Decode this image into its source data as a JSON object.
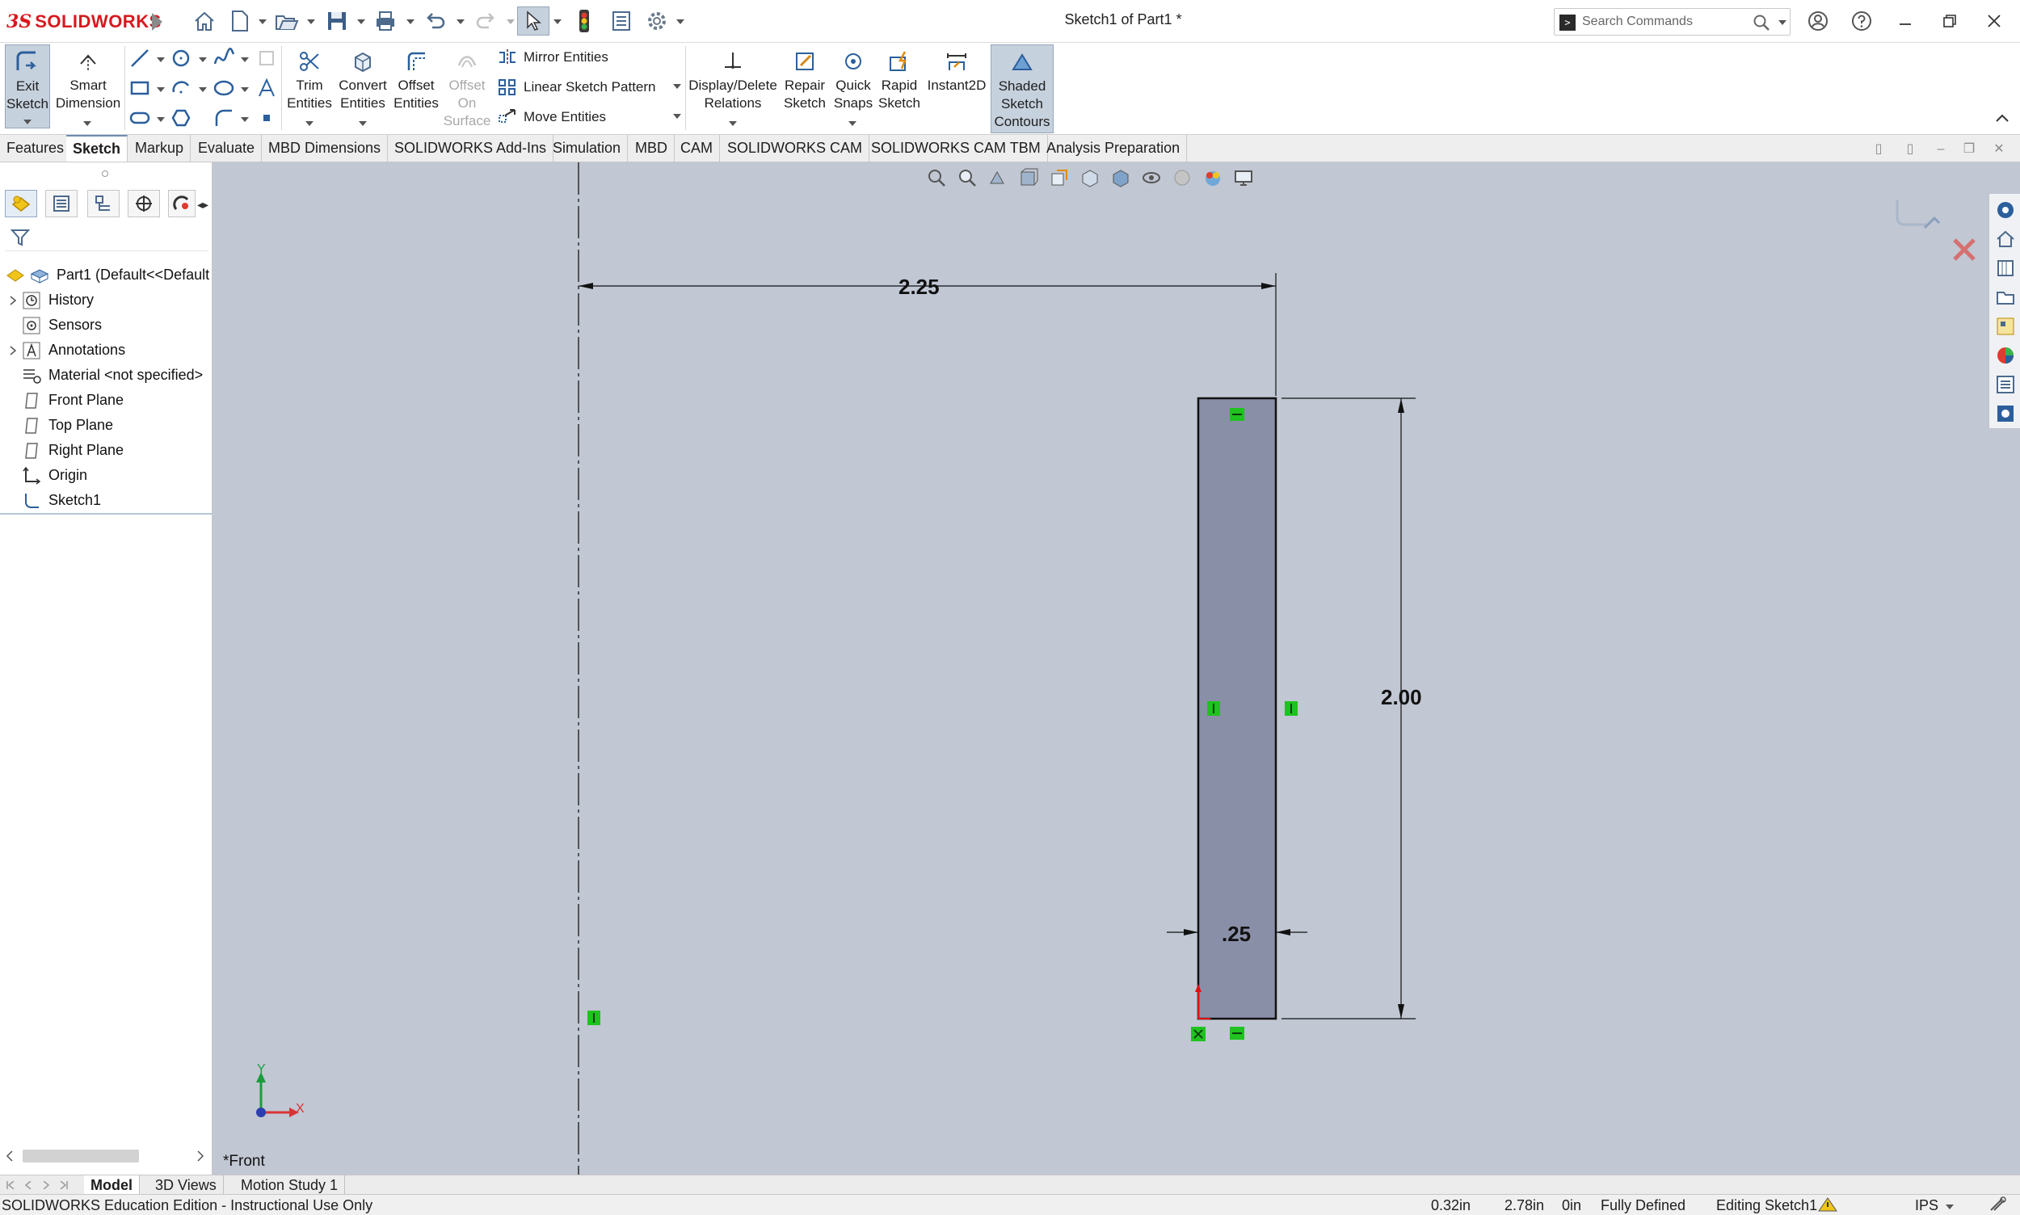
{
  "titlebar": {
    "brand": "SOLIDWORKS",
    "document_title": "Sketch1 of Part1 *",
    "search_placeholder": "Search Commands",
    "quick_access_icons": [
      "home-icon",
      "new-file-icon",
      "open-icon",
      "save-icon",
      "print-icon",
      "undo-icon",
      "redo-icon",
      "select-icon",
      "rebuild-icon",
      "file-properties-icon",
      "options-icon"
    ]
  },
  "ribbon": {
    "exit_sketch": [
      "Exit",
      "Sketch"
    ],
    "smart_dimension": [
      "Smart",
      "Dimension"
    ],
    "trim_entities": [
      "Trim",
      "Entities"
    ],
    "convert_entities": [
      "Convert",
      "Entities"
    ],
    "offset_entities": [
      "Offset",
      "Entities"
    ],
    "offset_on_surface": [
      "Offset",
      "On",
      "Surface"
    ],
    "mirror_entities": "Mirror Entities",
    "linear_sketch_pattern": "Linear Sketch Pattern",
    "move_entities": "Move Entities",
    "display_delete_relations": [
      "Display/Delete",
      "Relations"
    ],
    "repair_sketch": [
      "Repair",
      "Sketch"
    ],
    "quick_snaps": [
      "Quick",
      "Snaps"
    ],
    "rapid_sketch": [
      "Rapid",
      "Sketch"
    ],
    "instant2d": "Instant2D",
    "shaded_sketch_contours": [
      "Shaded",
      "Sketch",
      "Contours"
    ]
  },
  "command_tabs": [
    "Features",
    "Sketch",
    "Markup",
    "Evaluate",
    "MBD Dimensions",
    "SOLIDWORKS Add-Ins",
    "Simulation",
    "MBD",
    "CAM",
    "SOLIDWORKS CAM",
    "SOLIDWORKS CAM TBM",
    "Analysis Preparation"
  ],
  "active_tab": "Sketch",
  "feature_tree": {
    "root": "Part1  (Default<<Default",
    "items": [
      "History",
      "Sensors",
      "Annotations",
      "Material <not specified>",
      "Front Plane",
      "Top Plane",
      "Right Plane",
      "Origin",
      "Sketch1"
    ]
  },
  "sketch": {
    "dim_horizontal": "2.25",
    "dim_vertical": "2.00",
    "dim_width": ".25",
    "fill_color": "#8a8fa8",
    "canvas_color": "#c1c7d3",
    "relation_color": "#1fc21f"
  },
  "triad": {
    "y_label": "Y",
    "x_label": "X"
  },
  "view_label": "*Front",
  "bottom_tabs": [
    "Model",
    "3D Views",
    "Motion Study 1"
  ],
  "status": {
    "edition": "SOLIDWORKS Education Edition - Instructional Use Only",
    "x": "0.32in",
    "y": "2.78in",
    "z": "0in",
    "state": "Fully Defined",
    "editing": "Editing Sketch1",
    "units": "IPS"
  }
}
